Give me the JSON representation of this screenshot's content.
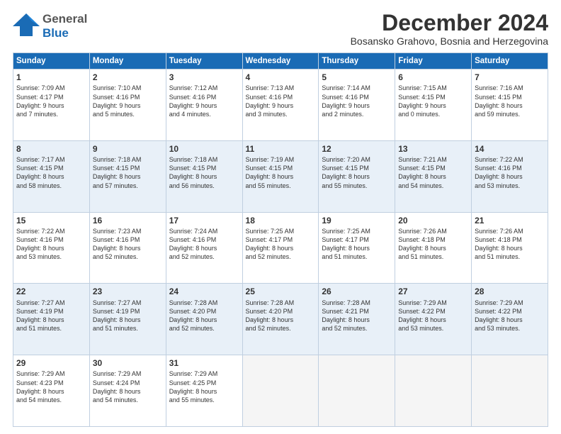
{
  "header": {
    "logo_general": "General",
    "logo_blue": "Blue",
    "month": "December 2024",
    "location": "Bosansko Grahovo, Bosnia and Herzegovina"
  },
  "weekdays": [
    "Sunday",
    "Monday",
    "Tuesday",
    "Wednesday",
    "Thursday",
    "Friday",
    "Saturday"
  ],
  "weeks": [
    [
      {
        "day": "1",
        "info": "Sunrise: 7:09 AM\nSunset: 4:17 PM\nDaylight: 9 hours\nand 7 minutes."
      },
      {
        "day": "2",
        "info": "Sunrise: 7:10 AM\nSunset: 4:16 PM\nDaylight: 9 hours\nand 5 minutes."
      },
      {
        "day": "3",
        "info": "Sunrise: 7:12 AM\nSunset: 4:16 PM\nDaylight: 9 hours\nand 4 minutes."
      },
      {
        "day": "4",
        "info": "Sunrise: 7:13 AM\nSunset: 4:16 PM\nDaylight: 9 hours\nand 3 minutes."
      },
      {
        "day": "5",
        "info": "Sunrise: 7:14 AM\nSunset: 4:16 PM\nDaylight: 9 hours\nand 2 minutes."
      },
      {
        "day": "6",
        "info": "Sunrise: 7:15 AM\nSunset: 4:15 PM\nDaylight: 9 hours\nand 0 minutes."
      },
      {
        "day": "7",
        "info": "Sunrise: 7:16 AM\nSunset: 4:15 PM\nDaylight: 8 hours\nand 59 minutes."
      }
    ],
    [
      {
        "day": "8",
        "info": "Sunrise: 7:17 AM\nSunset: 4:15 PM\nDaylight: 8 hours\nand 58 minutes."
      },
      {
        "day": "9",
        "info": "Sunrise: 7:18 AM\nSunset: 4:15 PM\nDaylight: 8 hours\nand 57 minutes."
      },
      {
        "day": "10",
        "info": "Sunrise: 7:18 AM\nSunset: 4:15 PM\nDaylight: 8 hours\nand 56 minutes."
      },
      {
        "day": "11",
        "info": "Sunrise: 7:19 AM\nSunset: 4:15 PM\nDaylight: 8 hours\nand 55 minutes."
      },
      {
        "day": "12",
        "info": "Sunrise: 7:20 AM\nSunset: 4:15 PM\nDaylight: 8 hours\nand 55 minutes."
      },
      {
        "day": "13",
        "info": "Sunrise: 7:21 AM\nSunset: 4:15 PM\nDaylight: 8 hours\nand 54 minutes."
      },
      {
        "day": "14",
        "info": "Sunrise: 7:22 AM\nSunset: 4:16 PM\nDaylight: 8 hours\nand 53 minutes."
      }
    ],
    [
      {
        "day": "15",
        "info": "Sunrise: 7:22 AM\nSunset: 4:16 PM\nDaylight: 8 hours\nand 53 minutes."
      },
      {
        "day": "16",
        "info": "Sunrise: 7:23 AM\nSunset: 4:16 PM\nDaylight: 8 hours\nand 52 minutes."
      },
      {
        "day": "17",
        "info": "Sunrise: 7:24 AM\nSunset: 4:16 PM\nDaylight: 8 hours\nand 52 minutes."
      },
      {
        "day": "18",
        "info": "Sunrise: 7:25 AM\nSunset: 4:17 PM\nDaylight: 8 hours\nand 52 minutes."
      },
      {
        "day": "19",
        "info": "Sunrise: 7:25 AM\nSunset: 4:17 PM\nDaylight: 8 hours\nand 51 minutes."
      },
      {
        "day": "20",
        "info": "Sunrise: 7:26 AM\nSunset: 4:18 PM\nDaylight: 8 hours\nand 51 minutes."
      },
      {
        "day": "21",
        "info": "Sunrise: 7:26 AM\nSunset: 4:18 PM\nDaylight: 8 hours\nand 51 minutes."
      }
    ],
    [
      {
        "day": "22",
        "info": "Sunrise: 7:27 AM\nSunset: 4:19 PM\nDaylight: 8 hours\nand 51 minutes."
      },
      {
        "day": "23",
        "info": "Sunrise: 7:27 AM\nSunset: 4:19 PM\nDaylight: 8 hours\nand 51 minutes."
      },
      {
        "day": "24",
        "info": "Sunrise: 7:28 AM\nSunset: 4:20 PM\nDaylight: 8 hours\nand 52 minutes."
      },
      {
        "day": "25",
        "info": "Sunrise: 7:28 AM\nSunset: 4:20 PM\nDaylight: 8 hours\nand 52 minutes."
      },
      {
        "day": "26",
        "info": "Sunrise: 7:28 AM\nSunset: 4:21 PM\nDaylight: 8 hours\nand 52 minutes."
      },
      {
        "day": "27",
        "info": "Sunrise: 7:29 AM\nSunset: 4:22 PM\nDaylight: 8 hours\nand 53 minutes."
      },
      {
        "day": "28",
        "info": "Sunrise: 7:29 AM\nSunset: 4:22 PM\nDaylight: 8 hours\nand 53 minutes."
      }
    ],
    [
      {
        "day": "29",
        "info": "Sunrise: 7:29 AM\nSunset: 4:23 PM\nDaylight: 8 hours\nand 54 minutes."
      },
      {
        "day": "30",
        "info": "Sunrise: 7:29 AM\nSunset: 4:24 PM\nDaylight: 8 hours\nand 54 minutes."
      },
      {
        "day": "31",
        "info": "Sunrise: 7:29 AM\nSunset: 4:25 PM\nDaylight: 8 hours\nand 55 minutes."
      },
      {
        "day": "",
        "info": ""
      },
      {
        "day": "",
        "info": ""
      },
      {
        "day": "",
        "info": ""
      },
      {
        "day": "",
        "info": ""
      }
    ]
  ]
}
